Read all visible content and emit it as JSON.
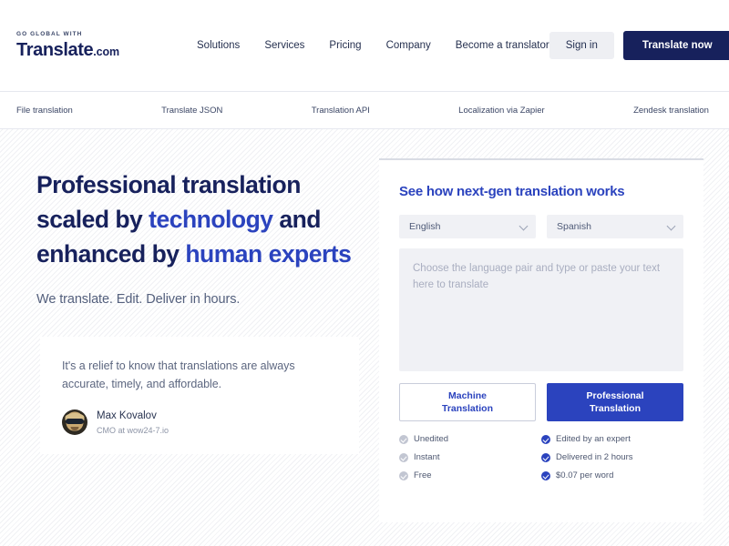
{
  "header": {
    "logo": {
      "kicker": "GO GLOBAL WITH",
      "name": "Translate",
      "tld": ".com"
    },
    "nav": [
      {
        "label": "Solutions"
      },
      {
        "label": "Services"
      },
      {
        "label": "Pricing"
      },
      {
        "label": "Company"
      },
      {
        "label": "Become a translator"
      }
    ],
    "signin_label": "Sign in",
    "cta_label": "Translate now"
  },
  "subnav": [
    {
      "label": "File translation"
    },
    {
      "label": "Translate JSON"
    },
    {
      "label": "Translation API"
    },
    {
      "label": "Localization via Zapier"
    },
    {
      "label": "Zendesk translation"
    }
  ],
  "hero": {
    "headline": {
      "part1": "Professional translation scaled by ",
      "highlight1": "technology",
      "part2": " and enhanced by ",
      "highlight2": "human experts"
    },
    "subhead": "We translate. Edit. Deliver in hours.",
    "testimonial": {
      "quote": "It's a relief to know that translations are always accurate, timely, and affordable.",
      "author_name": "Max Kovalov",
      "author_role": "CMO at wow24-7.io"
    }
  },
  "widget": {
    "title": "See how next-gen translation works",
    "source_language": "English",
    "target_language": "Spanish",
    "textarea_placeholder": "Choose the language pair and type or paste your text here to translate",
    "modes": {
      "machine": "Machine Translation",
      "machine_line1": "Machine",
      "machine_line2": "Translation",
      "professional": "Professional Translation",
      "professional_line1": "Professional",
      "professional_line2": "Translation"
    },
    "features_machine": [
      {
        "label": "Unedited"
      },
      {
        "label": "Instant"
      },
      {
        "label": "Free"
      }
    ],
    "features_professional": [
      {
        "label": "Edited by an expert"
      },
      {
        "label": "Delivered in 2 hours"
      },
      {
        "label": "$0.07 per word"
      }
    ]
  },
  "colors": {
    "navy": "#17215c",
    "blue": "#2b43be",
    "muted": "#54607d",
    "panel_bg": "#f0f1f5"
  }
}
